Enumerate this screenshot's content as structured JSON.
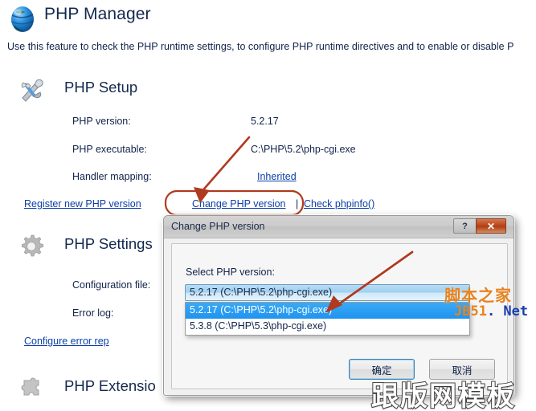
{
  "page": {
    "icon": "globe-icon",
    "title": "PHP Manager",
    "description": "Use this feature to check the PHP runtime settings, to configure PHP runtime directives and to enable or disable P"
  },
  "sections": [
    {
      "id": "php-setup",
      "icon": "wrench-hammer-icon",
      "title": "PHP Setup",
      "fields": [
        {
          "label": "PHP version:",
          "value": "5.2.17",
          "is_link": false
        },
        {
          "label": "PHP executable:",
          "value": "C:\\PHP\\5.2\\php-cgi.exe",
          "is_link": false
        },
        {
          "label": "Handler mapping:",
          "value": "Inherited",
          "is_link": true
        }
      ],
      "links": [
        "Register new PHP version",
        "Change PHP version",
        "Check phpinfo()"
      ],
      "link_separator": "|"
    },
    {
      "id": "php-settings",
      "icon": "gear-icon",
      "title": "PHP Settings",
      "fields": [
        {
          "label": "Configuration file:",
          "value": "",
          "is_link": false
        },
        {
          "label": "Error log:",
          "value": "",
          "is_link": false
        }
      ],
      "links": [
        "Configure error rep"
      ]
    },
    {
      "id": "php-extensions",
      "icon": "puzzle-icon",
      "title": "PHP Extensio"
    }
  ],
  "dialog": {
    "title": "Change PHP version",
    "help_button": "?",
    "close_button": "✕",
    "field_label": "Select PHP version:",
    "combo_selected": "5.2.17 (C:\\PHP\\5.2\\php-cgi.exe)",
    "options": [
      {
        "label": "5.2.17 (C:\\PHP\\5.2\\php-cgi.exe)",
        "selected": true
      },
      {
        "label": "5.3.8 (C:\\PHP\\5.3\\php-cgi.exe)",
        "selected": false
      }
    ],
    "ok_button": "确定",
    "cancel_button": "取消"
  },
  "watermarks": {
    "cn_top": "脚本之家",
    "jb_orange": "JB51",
    "jb_blue": ". Net",
    "bottom": "跟版网模板"
  },
  "colors": {
    "link": "#0b3fa8",
    "heading": "#12294e",
    "annotation": "#b03a1e",
    "highlight": "#2a9df4",
    "watermark_orange": "#e8821e",
    "watermark_blue": "#1a3fae"
  }
}
